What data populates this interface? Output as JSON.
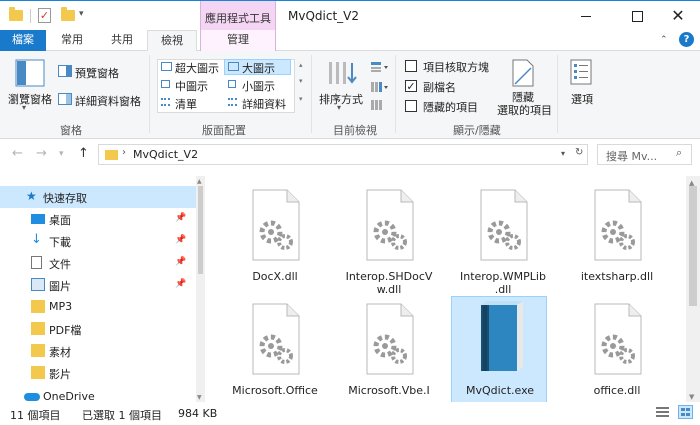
{
  "window": {
    "title": "MvQdict_V2",
    "contextual_tab_title": "應用程式工具"
  },
  "tabs": {
    "file": "檔案",
    "home": "常用",
    "share": "共用",
    "view": "檢視",
    "manage": "管理"
  },
  "ribbon": {
    "panes": {
      "navigation_pane": "瀏覽窗格",
      "preview_pane": "預覽窗格",
      "details_pane": "詳細資料窗格",
      "group_label": "窗格"
    },
    "layout": {
      "extra_large": "超大圖示",
      "large": "大圖示",
      "medium": "中圖示",
      "small": "小圖示",
      "list": "清單",
      "details": "詳細資料",
      "group_label": "版面配置"
    },
    "current_view": {
      "sort_by": "排序方式",
      "group_label": "目前檢視"
    },
    "show_hide": {
      "item_check_boxes": "項目核取方塊",
      "file_name_extensions": "副檔名",
      "hidden_items": "隱藏的項目",
      "hide_selected_line1": "隱藏",
      "hide_selected_line2": "選取的項目",
      "group_label": "顯示/隱藏",
      "item_check_boxes_checked": false,
      "file_name_extensions_checked": true,
      "hidden_items_checked": false
    },
    "options": "選項"
  },
  "address": {
    "path": "MvQdict_V2",
    "search_placeholder": "搜尋 Mv..."
  },
  "nav": {
    "quick_access": "快速存取",
    "items": [
      {
        "label": "桌面"
      },
      {
        "label": "下載"
      },
      {
        "label": "文件"
      },
      {
        "label": "圖片"
      },
      {
        "label": "MP3"
      },
      {
        "label": "PDF檔"
      },
      {
        "label": "素材"
      },
      {
        "label": "影片"
      }
    ],
    "onedrive": "OneDrive"
  },
  "files": [
    {
      "line1": "DocX.dll",
      "line2": ""
    },
    {
      "line1": "Interop.SHDocV",
      "line2": "w.dll"
    },
    {
      "line1": "Interop.WMPLib",
      "line2": ".dll"
    },
    {
      "line1": "itextsharp.dll",
      "line2": ""
    },
    {
      "line1": "Microsoft.Office",
      "line2": ""
    },
    {
      "line1": "Microsoft.Vbe.I",
      "line2": ""
    },
    {
      "line1": "MvQdict.exe",
      "line2": ""
    },
    {
      "line1": "office.dll",
      "line2": ""
    }
  ],
  "status": {
    "item_count": "11 個項目",
    "selected": "已選取 1 個項目",
    "size": "984 KB"
  },
  "colors": {
    "accent": "#1979ca",
    "selection": "#cce8ff",
    "contextual": "#f4d6f4"
  }
}
